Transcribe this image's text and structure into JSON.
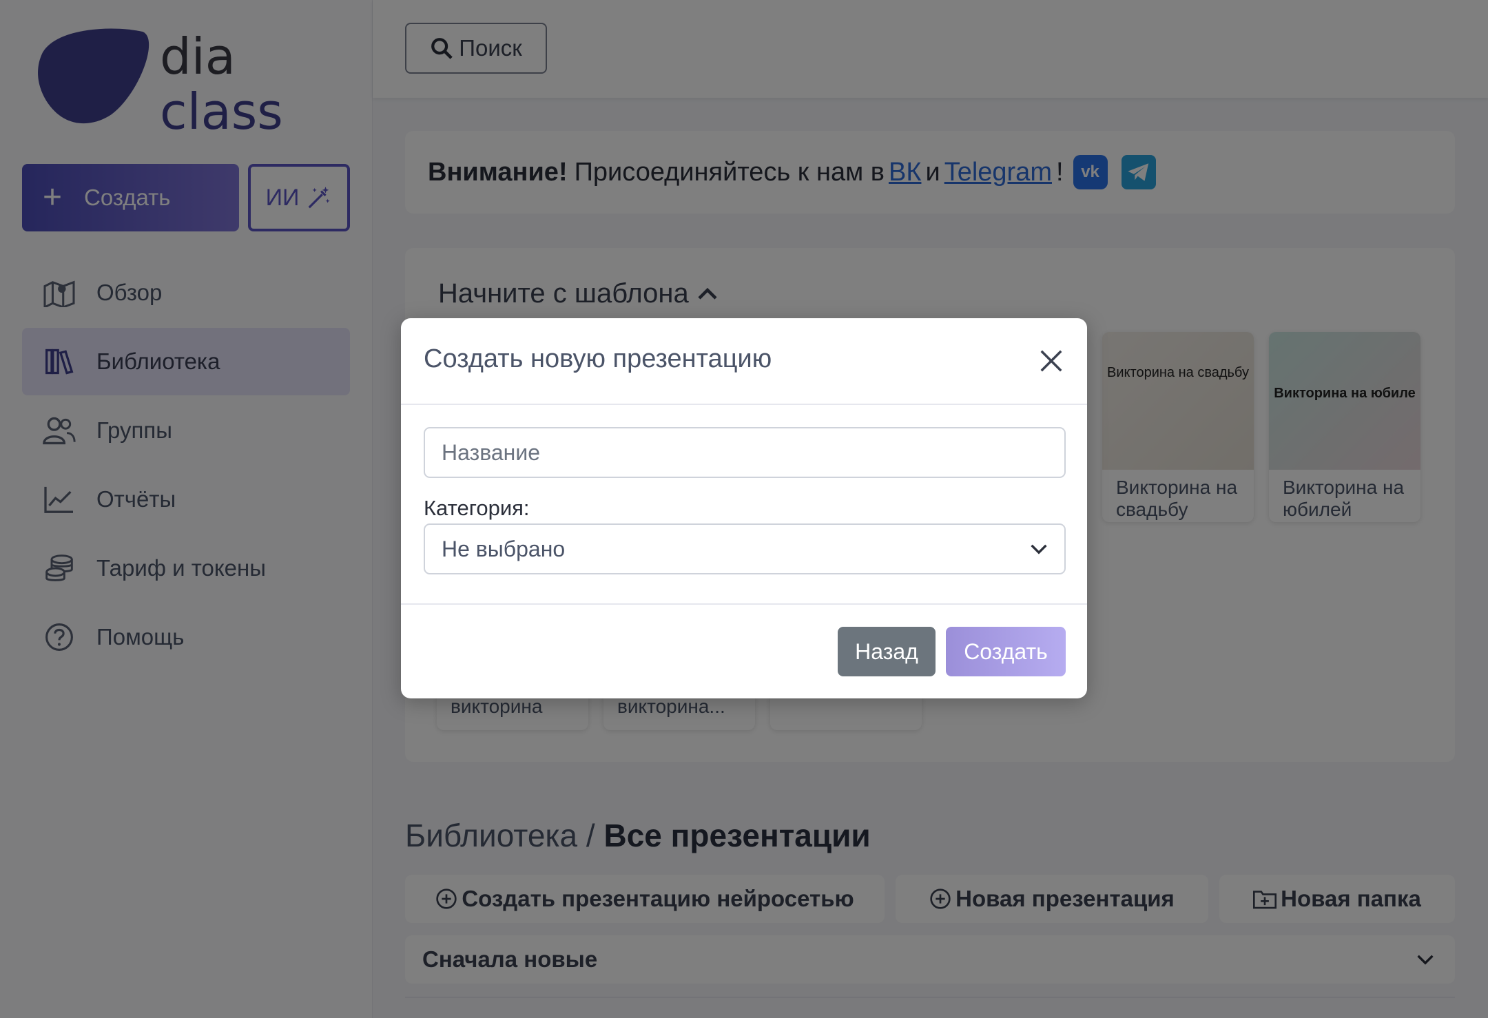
{
  "logo": {
    "line1": "dia",
    "line2": "class"
  },
  "sidebar": {
    "create_label": "Создать",
    "ai_label": "ИИ",
    "items": [
      {
        "label": "Обзор",
        "icon": "map-icon"
      },
      {
        "label": "Библиотека",
        "icon": "books-icon",
        "active": true
      },
      {
        "label": "Группы",
        "icon": "users-icon"
      },
      {
        "label": "Отчёты",
        "icon": "chart-line-icon"
      },
      {
        "label": "Тариф и токены",
        "icon": "coins-icon"
      },
      {
        "label": "Помощь",
        "icon": "question-circle-icon"
      }
    ]
  },
  "topbar": {
    "search_label": "Поиск"
  },
  "notice": {
    "bold": "Внимание!",
    "text": "Присоединяйтесь к нам в",
    "vk_link": "ВК",
    "and": "и",
    "tg_link": "Telegram",
    "excl": "!"
  },
  "templates": {
    "title": "Начните с шаблона",
    "cards": [
      {
        "thumb_text": "Викторина на свадьбу",
        "label": "Викторина на свадьбу"
      },
      {
        "thumb_text": "Викторина на юбиле",
        "label": "Викторина на юбилей"
      },
      {
        "label": "викторина"
      },
      {
        "label": "викторина..."
      },
      {
        "label": ""
      }
    ]
  },
  "library": {
    "crumb": "Библиотека /",
    "title": "Все презентации",
    "btn_ai": "Создать презентацию нейросетью",
    "btn_new": "Новая презентация",
    "btn_folder": "Новая папка",
    "sort": "Сначала новые"
  },
  "modal": {
    "title": "Создать новую презентацию",
    "name_placeholder": "Название",
    "category_label": "Категория:",
    "category_value": "Не выбрано",
    "back_label": "Назад",
    "submit_label": "Создать"
  },
  "colors": {
    "accent": "#5b54c4",
    "vk": "#2a73e8",
    "telegram": "#2aa3dd",
    "secondary": "#6c757d"
  }
}
